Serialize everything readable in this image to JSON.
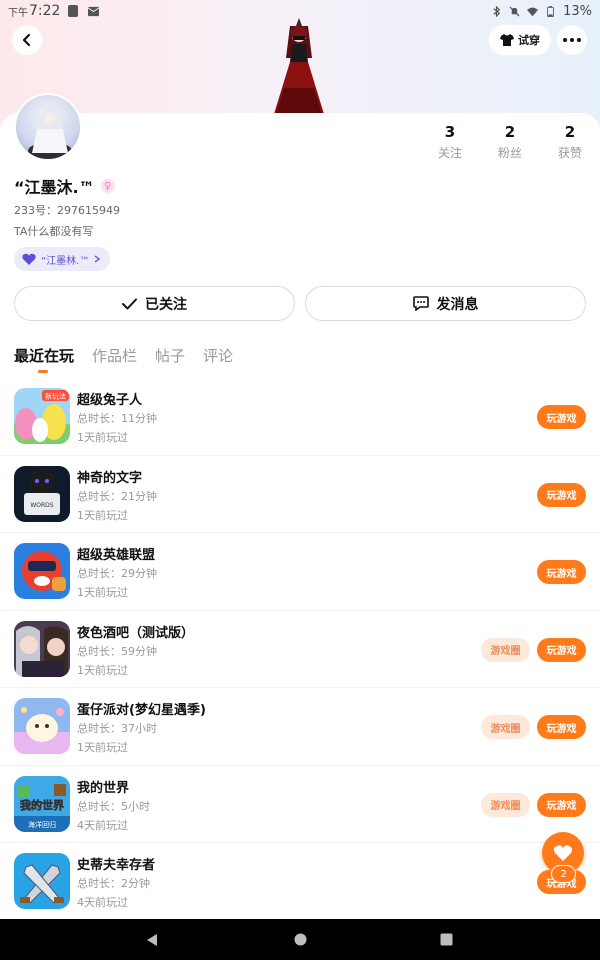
{
  "status_bar": {
    "time_prefix": "下午",
    "time": "7:22",
    "battery": "13%"
  },
  "header": {
    "try_on_label": "试穿"
  },
  "profile": {
    "nickname": "“江墨沐.™",
    "uid_line": "233号：297615949",
    "bio": "TA什么都没有写",
    "club_label": "“江墨林.™",
    "gender_symbol": "♀"
  },
  "stats": [
    {
      "value": "3",
      "label": "关注"
    },
    {
      "value": "2",
      "label": "粉丝"
    },
    {
      "value": "2",
      "label": "获赞"
    }
  ],
  "actions": {
    "follow_label": "已关注",
    "message_label": "发消息"
  },
  "tabs": [
    {
      "label": "最近在玩",
      "active": true
    },
    {
      "label": "作品栏",
      "active": false
    },
    {
      "label": "帖子",
      "active": false
    },
    {
      "label": "评论",
      "active": false
    }
  ],
  "games": [
    {
      "name": "超级兔子人",
      "duration": "总时长：11分钟",
      "last_played": "1天前玩过",
      "play_label": "玩游戏",
      "has_circle": false,
      "circle_label": ""
    },
    {
      "name": "神奇的文字",
      "duration": "总时长：21分钟",
      "last_played": "1天前玩过",
      "play_label": "玩游戏",
      "has_circle": false,
      "circle_label": ""
    },
    {
      "name": "超级英雄联盟",
      "duration": "总时长：29分钟",
      "last_played": "1天前玩过",
      "play_label": "玩游戏",
      "has_circle": false,
      "circle_label": ""
    },
    {
      "name": "夜色酒吧（测试版）",
      "duration": "总时长：59分钟",
      "last_played": "1天前玩过",
      "play_label": "玩游戏",
      "has_circle": true,
      "circle_label": "游戏圈"
    },
    {
      "name": "蛋仔派对(梦幻星遇季)",
      "duration": "总时长：37小时",
      "last_played": "1天前玩过",
      "play_label": "玩游戏",
      "has_circle": true,
      "circle_label": "游戏圈"
    },
    {
      "name": "我的世界",
      "duration": "总时长：5小时",
      "last_played": "4天前玩过",
      "play_label": "玩游戏",
      "has_circle": true,
      "circle_label": "游戏圈"
    },
    {
      "name": "史蒂夫幸存者",
      "duration": "总时长：2分钟",
      "last_played": "4天前玩过",
      "play_label": "玩游戏",
      "has_circle": false,
      "circle_label": ""
    }
  ],
  "thumb_text": {
    "rabbit_badge": "新玩法",
    "minecraft_title": "我的世界",
    "minecraft_sub": "海洋回归",
    "words_sign": "WORDS"
  },
  "like_fab": {
    "count": "2"
  },
  "colors": {
    "accent": "#ff7a1a",
    "circle_bg": "#fde8dc",
    "club_text": "#5b4fd3"
  }
}
